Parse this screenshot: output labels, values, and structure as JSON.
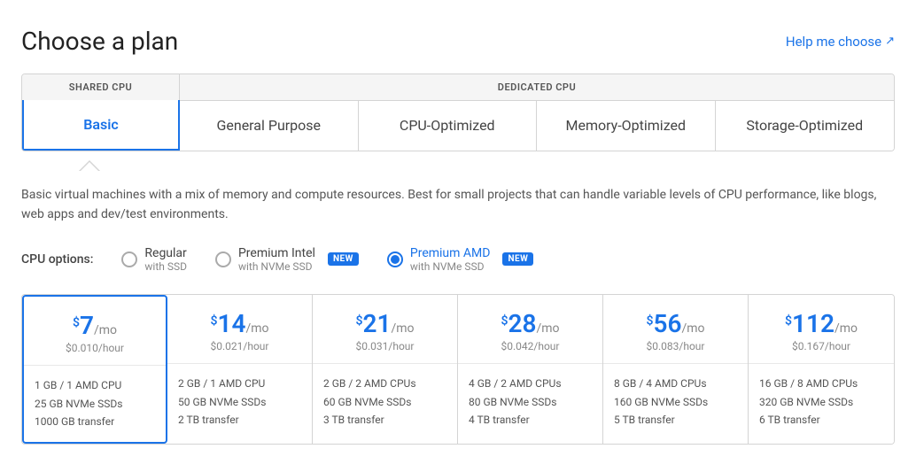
{
  "header": {
    "title": "Choose a plan",
    "help_link": "Help me choose"
  },
  "tabs": {
    "shared_cpu_label": "SHARED CPU",
    "dedicated_cpu_label": "DEDICATED CPU",
    "items": [
      {
        "id": "basic",
        "label": "Basic",
        "active": true
      },
      {
        "id": "general",
        "label": "General Purpose",
        "active": false
      },
      {
        "id": "cpu",
        "label": "CPU-Optimized",
        "active": false
      },
      {
        "id": "memory",
        "label": "Memory-Optimized",
        "active": false
      },
      {
        "id": "storage",
        "label": "Storage-Optimized",
        "active": false
      }
    ]
  },
  "description": "Basic virtual machines with a mix of memory and compute resources. Best for small projects that can handle variable levels of CPU performance, like blogs, web apps and dev/test environments.",
  "cpu_options": {
    "label": "CPU options:",
    "options": [
      {
        "id": "regular",
        "label": "Regular",
        "sublabel": "with SSD",
        "selected": false,
        "badge": null
      },
      {
        "id": "premium-intel",
        "label": "Premium Intel",
        "sublabel": "with NVMe SSD",
        "selected": false,
        "badge": "NEW"
      },
      {
        "id": "premium-amd",
        "label": "Premium AMD",
        "sublabel": "with NVMe SSD",
        "selected": true,
        "badge": "NEW"
      }
    ]
  },
  "pricing_cards": [
    {
      "id": "plan-7",
      "selected": true,
      "price_dollar": "$",
      "price_amount": "7",
      "price_per": "/mo",
      "price_hourly": "$0.010/hour",
      "specs": [
        "1 GB / 1 AMD CPU",
        "25 GB NVMe SSDs",
        "1000 GB transfer"
      ]
    },
    {
      "id": "plan-14",
      "selected": false,
      "price_dollar": "$",
      "price_amount": "14",
      "price_per": "/mo",
      "price_hourly": "$0.021/hour",
      "specs": [
        "2 GB / 1 AMD CPU",
        "50 GB NVMe SSDs",
        "2 TB transfer"
      ]
    },
    {
      "id": "plan-21",
      "selected": false,
      "price_dollar": "$",
      "price_amount": "21",
      "price_per": "/mo",
      "price_hourly": "$0.031/hour",
      "specs": [
        "2 GB / 2 AMD CPUs",
        "60 GB NVMe SSDs",
        "3 TB transfer"
      ]
    },
    {
      "id": "plan-28",
      "selected": false,
      "price_dollar": "$",
      "price_amount": "28",
      "price_per": "/mo",
      "price_hourly": "$0.042/hour",
      "specs": [
        "4 GB / 2 AMD CPUs",
        "80 GB NVMe SSDs",
        "4 TB transfer"
      ]
    },
    {
      "id": "plan-56",
      "selected": false,
      "price_dollar": "$",
      "price_amount": "56",
      "price_per": "/mo",
      "price_hourly": "$0.083/hour",
      "specs": [
        "8 GB / 4 AMD CPUs",
        "160 GB NVMe SSDs",
        "5 TB transfer"
      ]
    },
    {
      "id": "plan-112",
      "selected": false,
      "price_dollar": "$",
      "price_amount": "112",
      "price_per": "/mo",
      "price_hourly": "$0.167/hour",
      "specs": [
        "16 GB / 8 AMD CPUs",
        "320 GB NVMe SSDs",
        "6 TB transfer"
      ]
    }
  ]
}
